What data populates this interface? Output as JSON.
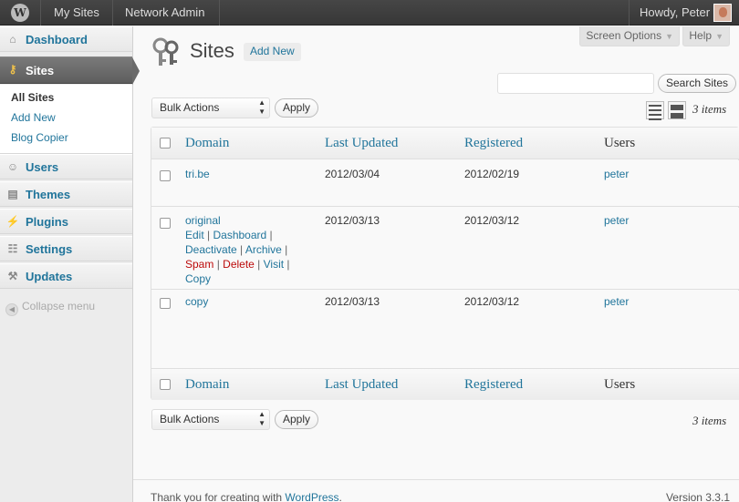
{
  "adminbar": {
    "my_sites": "My Sites",
    "network_admin": "Network Admin",
    "howdy": "Howdy, Peter"
  },
  "sidebar": {
    "items": [
      {
        "label": "Dashboard",
        "icon": "home-icon"
      },
      {
        "label": "Sites",
        "icon": "keys-icon"
      },
      {
        "label": "Users",
        "icon": "users-icon"
      },
      {
        "label": "Themes",
        "icon": "themes-icon"
      },
      {
        "label": "Plugins",
        "icon": "plugins-icon"
      },
      {
        "label": "Settings",
        "icon": "settings-icon"
      },
      {
        "label": "Updates",
        "icon": "tools-icon"
      }
    ],
    "submenu": [
      "All Sites",
      "Add New",
      "Blog Copier"
    ],
    "collapse": "Collapse menu"
  },
  "screen_meta": {
    "screen_options": "Screen Options",
    "help": "Help"
  },
  "page": {
    "title": "Sites",
    "add_new": "Add New",
    "search_value": "",
    "search_button": "Search Sites",
    "bulk_actions": "Bulk Actions",
    "apply": "Apply",
    "items_count": "3 items"
  },
  "table": {
    "columns": [
      "Domain",
      "Last Updated",
      "Registered",
      "Users"
    ],
    "rows": [
      {
        "domain": "tri.be",
        "updated": "2012/03/04",
        "registered": "2012/02/19",
        "users": "peter"
      },
      {
        "domain": "original",
        "updated": "2012/03/13",
        "registered": "2012/03/12",
        "users": "peter"
      },
      {
        "domain": "copy",
        "updated": "2012/03/13",
        "registered": "2012/03/12",
        "users": "peter"
      }
    ],
    "row_actions": [
      "Edit",
      "Dashboard",
      "Deactivate",
      "Archive",
      "Spam",
      "Delete",
      "Visit",
      "Copy"
    ]
  },
  "footer": {
    "thanks": "Thank you for creating with ",
    "wordpress": "WordPress",
    "period": ".",
    "version": "Version 3.3.1"
  },
  "colors": {
    "link": "#21759b",
    "delete_red": "#bc0b0b",
    "adminbar": "#464646"
  }
}
